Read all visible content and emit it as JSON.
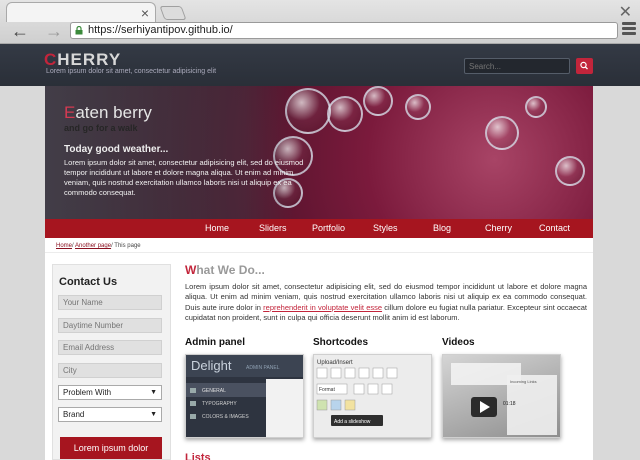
{
  "browser": {
    "url": "https://serhiyantipov.github.io/",
    "tab_close": "×",
    "window_close": "✕",
    "back": "←",
    "forward": "→"
  },
  "header": {
    "logo_first": "C",
    "logo_rest": "HERRY",
    "tagline": "Lorem ipsum dolor sit amet, consectetur adipisicing elit",
    "search_placeholder": "Search..."
  },
  "hero": {
    "title_first": "E",
    "title_rest": "aten berry",
    "subtitle": "and go for a walk",
    "heading": "Today good weather...",
    "text": "Lorem ipsum dolor sit amet, consectetur adipisicing elit, sed do eiusmod tempor incididunt ut labore et dolore magna aliqua. Ut enim ad minim veniam, quis nostrud exercitation ullamco laboris nisi ut aliquip ex ea commodo consequat."
  },
  "nav": {
    "items": [
      "Home",
      "Sliders",
      "Portfolio",
      "Styles",
      "Blog",
      "Cherry",
      "Contact"
    ]
  },
  "breadcrumb": {
    "home": "Home",
    "another": "Another page",
    "current": "This page"
  },
  "contact": {
    "title": "Contact  Us",
    "fields": [
      "Your Name",
      "Daytime Number",
      "Email Address",
      "City"
    ],
    "select1": "Problem With",
    "select2": "Brand",
    "submit": "Lorem ipsum dolor",
    "arrow": "▼"
  },
  "what_we_do": {
    "title_first": "W",
    "title_rest": "hat We Do...",
    "text_before": "Lorem ipsum dolor sit amet, consectetur adipisicing elit, sed do eiusmod tempor incididunt ut labore et dolore magna aliqua. Ut enim ad minim veniam, quis nostrud exercitation ullamco laboris nisi ut aliquip ex ea commodo consequat. Duis aute irure dolor in ",
    "link": "reprehenderit in voluptate velit esse",
    "text_after": " cillum dolore eu fugiat nulla pariatur. Excepteur sint occaecat cupidatat non proident, sunt in culpa qui officia deserunt mollit anim id est laborum."
  },
  "columns": {
    "admin": "Admin panel",
    "shortcodes": "Shortcodes",
    "videos": "Videos"
  },
  "thumbs": {
    "admin_logo": "Delight",
    "admin_caption": "ADMIN PANEL",
    "admin_menu": [
      "GENERAL",
      "TYPOGRAPHY",
      "COLORS & IMAGES"
    ],
    "short_header": "Upload/Insert",
    "short_format": "Format",
    "short_tooltip": "Add a slideshow",
    "video_time": "01:18",
    "video_label": "Incoming Links"
  },
  "lists": {
    "title": "Lists"
  }
}
